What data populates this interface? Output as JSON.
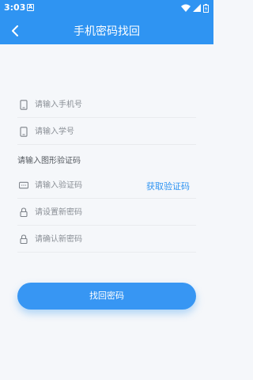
{
  "status_bar": {
    "time": "3:03",
    "notification_glyph": "A",
    "icons": [
      "wifi-icon",
      "signal-icon",
      "battery-icon"
    ]
  },
  "app_bar": {
    "title": "手机密码找回",
    "back_icon": "chevron-left-icon"
  },
  "form": {
    "phone": {
      "placeholder": "请输入手机号",
      "icon": "phone-icon"
    },
    "student_id": {
      "placeholder": "请输入学号",
      "icon": "phone-icon"
    },
    "captcha_label": "请输入图形验证码",
    "sms_code": {
      "placeholder": "请输入验证码",
      "icon": "sms-icon",
      "action_label": "获取验证码"
    },
    "new_password": {
      "placeholder": "请设置新密码",
      "icon": "lock-icon"
    },
    "confirm_password": {
      "placeholder": "请确认新密码",
      "icon": "lock-icon"
    },
    "submit_label": "找回密码"
  },
  "colors": {
    "primary": "#2f94f2",
    "background": "#f5f7fa",
    "divider": "#e9ebee",
    "placeholder": "#8a8f96"
  }
}
